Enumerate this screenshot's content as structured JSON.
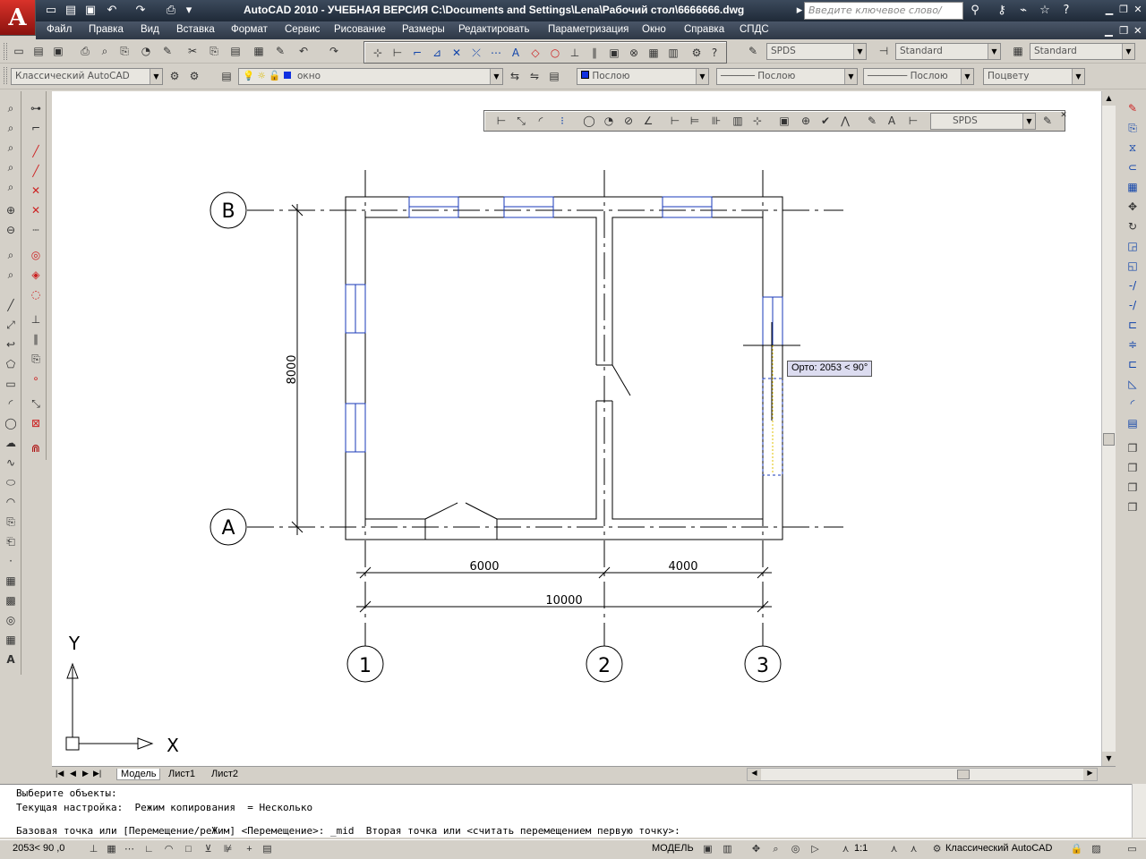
{
  "app": {
    "logo_letter": "A",
    "title": "AutoCAD 2010 - УЧЕБНАЯ ВЕРСИЯ    C:\\Documents and Settings\\Lena\\Рабочий стол\\6666666.dwg",
    "search_placeholder": "Введите ключевое слово/фразу"
  },
  "menu": {
    "items": [
      "Файл",
      "Правка",
      "Вид",
      "Вставка",
      "Формат",
      "Сервис",
      "Рисование",
      "Размеры",
      "Редактировать",
      "Параметризация",
      "Окно",
      "Справка",
      "СПДС"
    ]
  },
  "toolbar1": {
    "text_style": "SPDS",
    "dim_style": "Standard",
    "table_style": "Standard"
  },
  "toolbar2": {
    "workspace": "Классический AutoCAD",
    "layer": "окно",
    "color": "Послою",
    "linetype": "Послою",
    "lineweight": "Послою",
    "plotstyle": "Поцвету"
  },
  "float_toolbar": {
    "style": "SPDS"
  },
  "drawing": {
    "grid_labels": {
      "axis_b": "B",
      "axis_a": "A",
      "axis_1": "1",
      "axis_2": "2",
      "axis_3": "3"
    },
    "dimensions": {
      "vertical": "8000",
      "span_1": "6000",
      "span_2": "4000",
      "overall": "10000"
    },
    "ucs": {
      "x": "X",
      "y": "Y"
    },
    "tooltip": "Орто: 2053 < 90°"
  },
  "tabs": [
    "Модель",
    "Лист1",
    "Лист2"
  ],
  "command": {
    "line1": "Выберите объекты:",
    "line2": "Текущая настройка:  Режим копирования  = Несколько",
    "line3": "Базовая точка или [Перемещение/реЖим] <Перемещение>: _mid  Вторая точка или <считать перемещением первую точку>:"
  },
  "status": {
    "coords": "2053< 90 ,0",
    "model": "МОДЕЛЬ",
    "scale": "1:1",
    "workspace": "Классический AutoCAD"
  }
}
